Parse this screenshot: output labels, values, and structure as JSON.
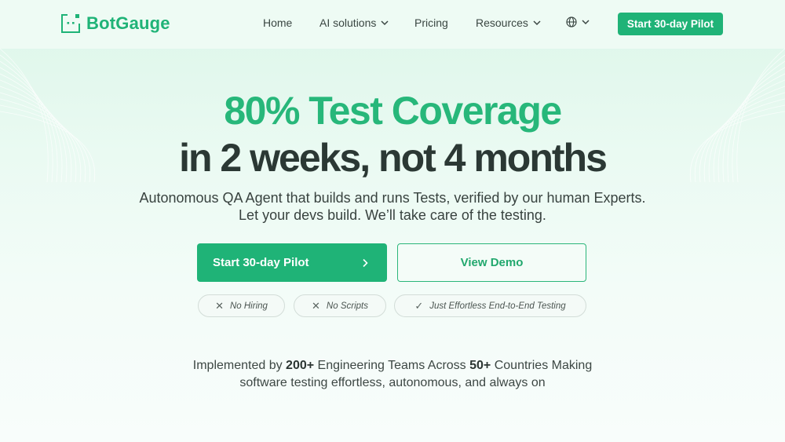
{
  "nav": {
    "logo_text": "BotGauge",
    "items": [
      {
        "label": "Home",
        "has_dropdown": false
      },
      {
        "label": "AI solutions",
        "has_dropdown": true
      },
      {
        "label": "Pricing",
        "has_dropdown": false
      },
      {
        "label": "Resources",
        "has_dropdown": true
      }
    ],
    "language_icon": "globe-icon",
    "cta_label": "Start 30-day Pilot"
  },
  "hero": {
    "headline_line1": "80% Test Coverage",
    "headline_line2": "in 2 weeks, not 4 months",
    "subtitle_line1": "Autonomous QA Agent that builds and runs Tests, verified by our human Experts.",
    "subtitle_line2": "Let your devs build. We’ll take care of the testing.",
    "primary_cta": "Start 30-day Pilot",
    "secondary_cta": "View Demo",
    "pills": [
      {
        "icon": "x-icon",
        "label": "No Hiring"
      },
      {
        "icon": "x-icon",
        "label": "No Scripts"
      },
      {
        "icon": "check-icon",
        "label": "Just Effortless End-to-End Testing"
      }
    ]
  },
  "stats": {
    "prefix": "Implemented by ",
    "teams": "200+",
    "middle": " Engineering Teams Across ",
    "countries": "50+",
    "suffix": " Countries Making",
    "line2": "software testing effortless, autonomous, and always on"
  },
  "colors": {
    "brand_green": "#1fb377",
    "headline_green": "#27b77a",
    "dark_text": "#2b3834"
  }
}
